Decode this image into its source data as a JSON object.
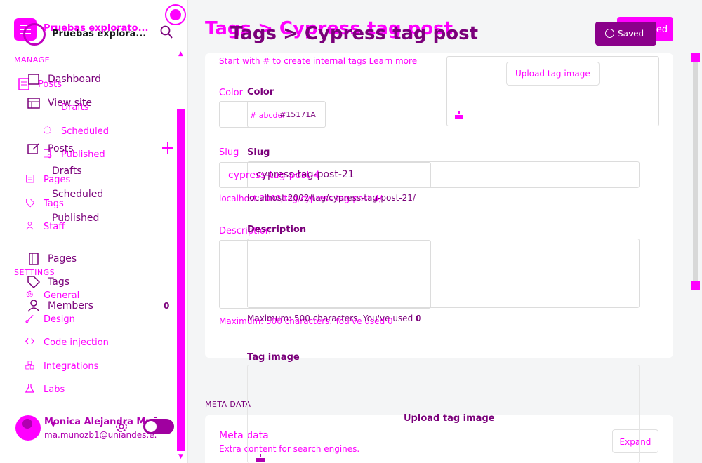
{
  "sidebar": {
    "site_title_a": "Pruebas explorato...",
    "site_title_b": "Pruebas explora...",
    "manage_label": "MANAGE",
    "settings_label": "SETTINGS",
    "items_pink": {
      "posts": "Posts",
      "drafts": "Drafts",
      "scheduled": "Scheduled",
      "published": "Published",
      "pages": "Pages",
      "tags": "Tags",
      "staff": "Staff",
      "general": "General",
      "design": "Design",
      "code_injection": "Code injection",
      "integrations": "Integrations",
      "labs": "Labs"
    },
    "items_dark": {
      "dashboard": "Dashboard",
      "view_site": "View site",
      "posts": "Posts",
      "drafts": "Drafts",
      "scheduled": "Scheduled",
      "published": "Published",
      "pages": "Pages",
      "tags": "Tags",
      "members": "Members"
    },
    "members_count": "0",
    "user": {
      "name": "Monica Alejandra Muñ...",
      "email": "ma.munozb1@uniandes.e..."
    }
  },
  "header": {
    "breadcrumb_pink": "Tags > Cypress tag post",
    "breadcrumb_dark": "Tags > Cypress tag post",
    "saved_pink": "Saved",
    "saved_dark": "Saved"
  },
  "form": {
    "intro_hint": "Start with # to create internal tags Learn more",
    "upload_button": "Upload tag image",
    "color_label_pink": "Color",
    "color_label_dark": "Color",
    "color_value": "#15171A",
    "color_placeholder": "# abcdef",
    "slug_label_pink": "Slug",
    "slug_label_dark": "Slug",
    "slug_value_pink": "cypress-tag-post-4",
    "slug_value_dark": "cypress-tag-post-21",
    "url_pink": "localhost:2002/tag/cypress-tag-post-4/",
    "url_dark": "localhost:2002/tag/cypress-tag-post-21/",
    "description_label_pink": "Description",
    "description_label_dark": "Description",
    "desc_hint_pink": "Maximum: 500 characters. You've used 0",
    "desc_hint_dark": "Maximum: 500 characters. You've used",
    "desc_hint_dark_count": "0",
    "tag_image_label": "Tag image",
    "upload_button_dark": "Upload tag image"
  },
  "meta": {
    "section_label": "META DATA",
    "title": "Meta data",
    "subtitle": "Extra content for search engines.",
    "expand_button": "Expand"
  },
  "colors": {
    "accent": "#ff00ff",
    "accent_dark": "#7a007a",
    "text": "#15171a"
  }
}
